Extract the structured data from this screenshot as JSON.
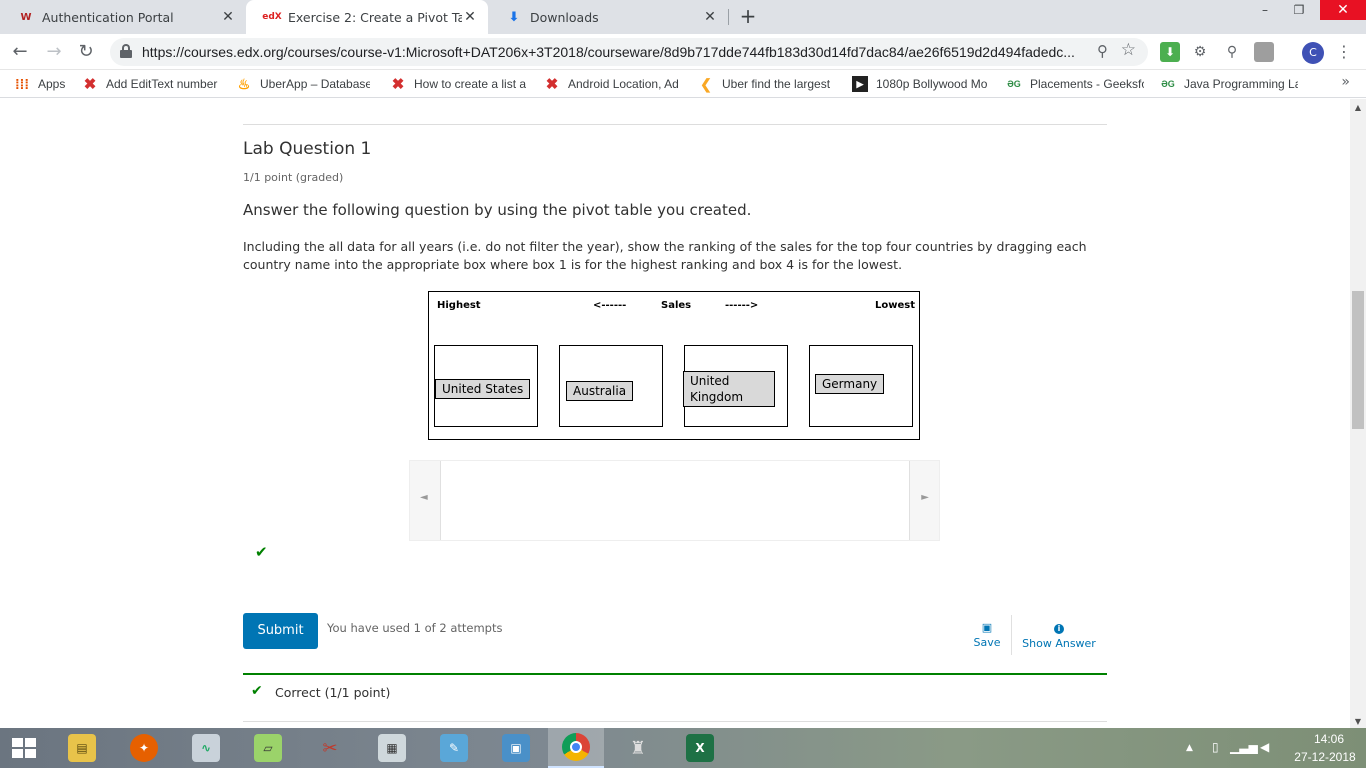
{
  "tabs": [
    {
      "title": "Authentication Portal",
      "favicon": "W"
    },
    {
      "title": "Exercise 2: Create a Pivot Table | E",
      "favicon": "edX"
    },
    {
      "title": "Downloads",
      "favicon": "download-arrow"
    }
  ],
  "new_tab_label": "+",
  "window_controls": {
    "minimize": "–",
    "restore": "❐",
    "close": "✕"
  },
  "address_bar": {
    "url": "https://courses.edx.org/courses/course-v1:Microsoft+DAT206x+3T2018/courseware/8d9b717dde744fb183d30d14fd7dac84/ae26f6519d2d494fadedc..."
  },
  "profile_initial": "C",
  "bookmarks": [
    {
      "label": "Apps",
      "icon": "apps-grid"
    },
    {
      "label": "Add EditText number",
      "icon": "x-logo"
    },
    {
      "label": "UberApp – Database",
      "icon": "firebase-flame"
    },
    {
      "label": "How to create a list a",
      "icon": "x-logo"
    },
    {
      "label": "Android Location, Ad",
      "icon": "x-logo"
    },
    {
      "label": "Uber find the largest",
      "icon": "arrow-logo"
    },
    {
      "label": "1080p Bollywood Mo",
      "icon": "play-logo"
    },
    {
      "label": "Placements - Geeksfo",
      "icon": "gfg-logo"
    },
    {
      "label": "Java Programming La",
      "icon": "gfg-logo"
    }
  ],
  "bookmarks_more": "»",
  "problem": {
    "title": "Lab Question 1",
    "points": "1/1 point (graded)",
    "prompt": "Answer the following question by using the pivot table you created.",
    "text": "Including the all data for all years (i.e. do not filter the year), show the ranking of the sales for the top four countries by dragging each country name into the appropriate box where box 1 is for the highest ranking and box 4 is for the lowest."
  },
  "drag_area": {
    "highest": "Highest",
    "arrow_left": "<------",
    "sales": "Sales",
    "arrow_right": "------>",
    "lowest": "Lowest",
    "placed": [
      "United States",
      "Australia",
      "United Kingdom",
      "Germany"
    ]
  },
  "pool": {
    "left_arrow": "◄",
    "right_arrow": "►"
  },
  "actions": {
    "submit": "Submit",
    "attempts": "You have used 1 of 2 attempts",
    "save": "Save",
    "show_answer": "Show Answer"
  },
  "notification": {
    "text": "Correct (1/1 point)"
  },
  "taskbar": {
    "time": "14:06",
    "date": "27-12-2018"
  }
}
